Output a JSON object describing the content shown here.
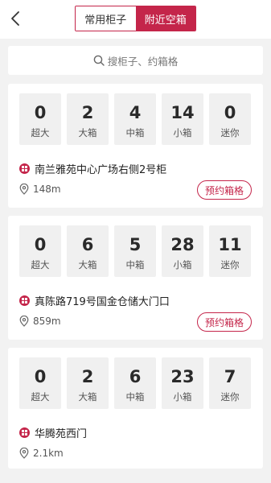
{
  "header": {
    "tabs": [
      {
        "label": "常用柜子",
        "active": false
      },
      {
        "label": "附近空箱",
        "active": true
      }
    ]
  },
  "search": {
    "placeholder": "搜柜子、约箱格"
  },
  "size_labels": [
    "超大",
    "大箱",
    "中箱",
    "小箱",
    "迷你"
  ],
  "cabinets": [
    {
      "name": "南兰雅苑中心广场右侧2号柜",
      "distance": "148m",
      "counts": [
        "0",
        "2",
        "4",
        "14",
        "0"
      ],
      "reserve_label": "预约箱格"
    },
    {
      "name": "真陈路719号国金仓储大门口",
      "distance": "859m",
      "counts": [
        "0",
        "6",
        "5",
        "28",
        "11"
      ],
      "reserve_label": "预约箱格"
    },
    {
      "name": "华腾苑西门",
      "distance": "2.1km",
      "counts": [
        "0",
        "2",
        "6",
        "23",
        "7"
      ]
    }
  ],
  "colors": {
    "accent": "#c4254a",
    "background": "#f2f2f2",
    "tile": "#f0f0f0"
  }
}
